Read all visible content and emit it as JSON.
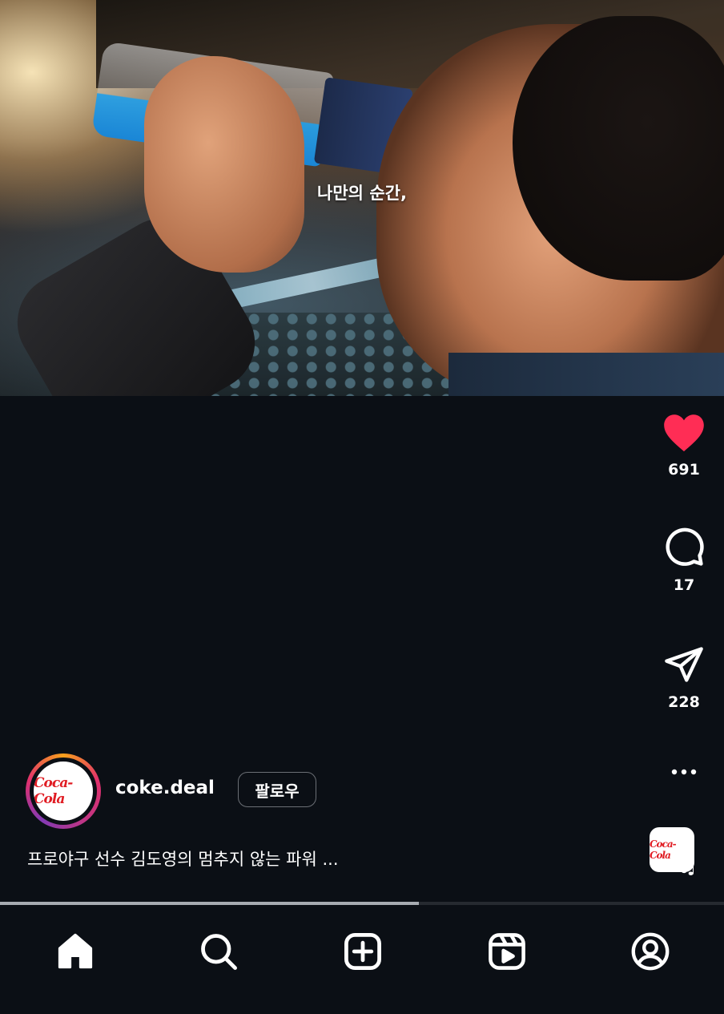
{
  "video": {
    "subtitle": "나만의 순간,"
  },
  "actions": {
    "like": {
      "icon": "heart-filled-icon",
      "count": "691",
      "color": "#ff2d55"
    },
    "comment": {
      "icon": "comment-icon",
      "count": "17"
    },
    "share": {
      "icon": "send-icon",
      "count": "228"
    },
    "more": {
      "icon": "more-dots-icon"
    }
  },
  "author": {
    "username": "coke.deal",
    "follow_label": "팔로우",
    "avatar_logo": "Coca-Cola"
  },
  "caption": "프로야구 선수 김도영의 멈추지 않는 파워 ...",
  "audio": {
    "logo": "Coca-Cola",
    "icon": "music-note-icon"
  },
  "playback": {
    "progress": 0.578
  },
  "nav": {
    "items": [
      {
        "icon": "home-icon",
        "active": true
      },
      {
        "icon": "search-icon",
        "active": false
      },
      {
        "icon": "create-icon",
        "active": false
      },
      {
        "icon": "reels-icon",
        "active": false
      },
      {
        "icon": "profile-icon",
        "active": false
      }
    ]
  },
  "colors": {
    "background": "#0b0f15",
    "like": "#ff2d55",
    "brand_red": "#e01b22",
    "progress": "#a7abb1"
  }
}
